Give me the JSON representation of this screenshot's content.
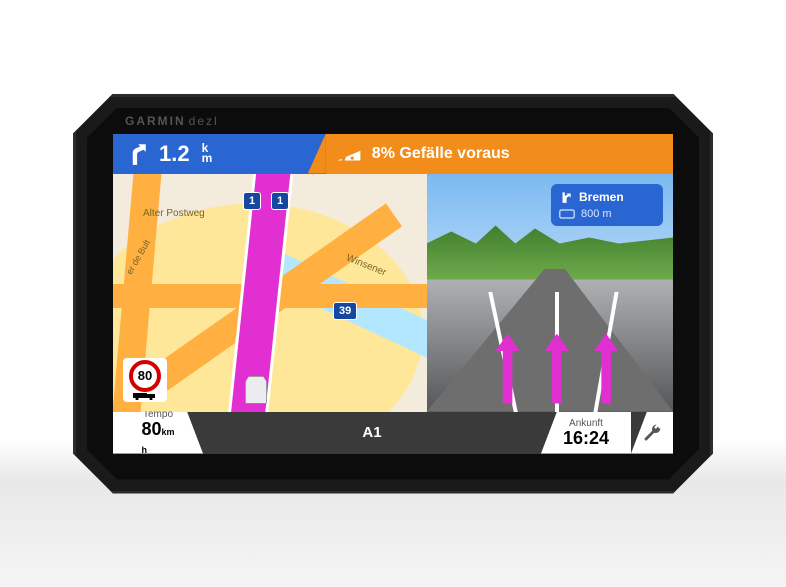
{
  "brand": {
    "line1": "GARMIN",
    "line2": "dezl"
  },
  "topbar": {
    "next_turn": {
      "distance": "1.2",
      "unit_top": "k",
      "unit_bot": "m",
      "icon": "bear-right-icon"
    },
    "warning": {
      "text": "8% Gefälle voraus",
      "icon": "grade-warning-icon"
    }
  },
  "map": {
    "shields": [
      "1",
      "1",
      "39"
    ],
    "road_names": [
      "Alter Postweg",
      "er de Bult",
      "Winsener"
    ],
    "speed_limit": "80"
  },
  "lane_view": {
    "sign": {
      "destination": "Bremen",
      "icon": "ramp-right-icon",
      "distance": "800 m",
      "distance_icon": "exit-icon"
    }
  },
  "bottom": {
    "tempo_label": "Tempo",
    "tempo_value": "80",
    "tempo_unit_top": "km",
    "tempo_unit_bot": "h",
    "current_road": "A1",
    "arrival_label": "Ankunft",
    "arrival_value": "16:24",
    "settings_icon": "wrench-icon"
  }
}
